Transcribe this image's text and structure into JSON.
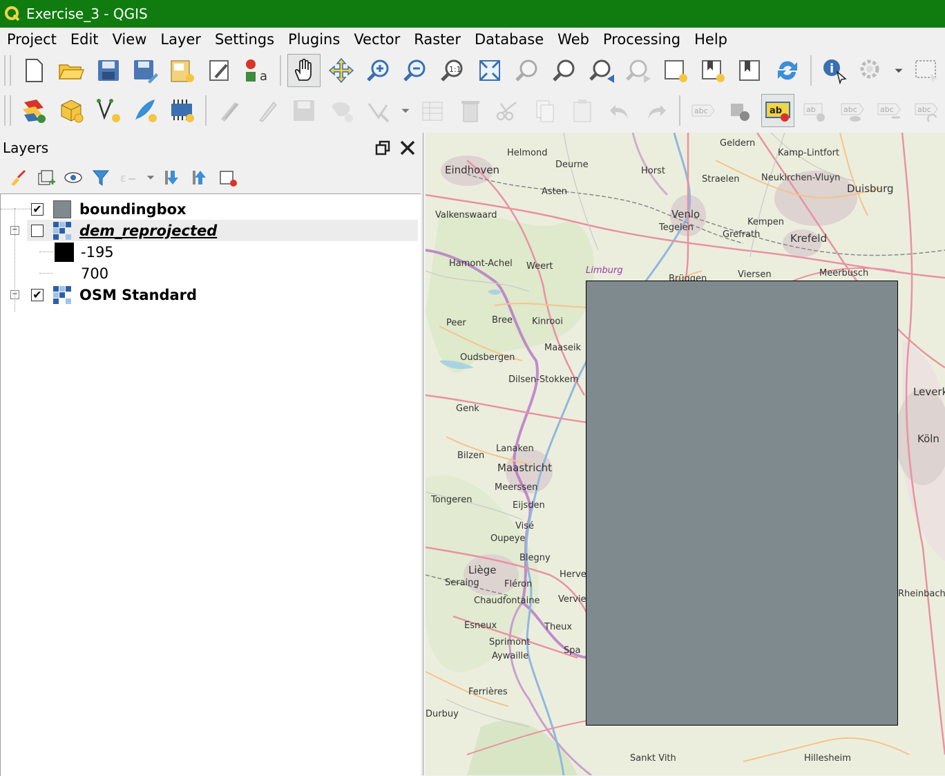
{
  "window": {
    "title": "Exercise_3 - QGIS"
  },
  "menu": [
    "Project",
    "Edit",
    "View",
    "Layer",
    "Settings",
    "Plugins",
    "Vector",
    "Raster",
    "Database",
    "Web",
    "Processing",
    "Help"
  ],
  "toolbar1": [
    "new-project",
    "open-project",
    "save-project",
    "save-as",
    "print-layout",
    "layout-manager",
    "style-manager",
    "pan-map",
    "pan-to-selection",
    "zoom-in",
    "zoom-out",
    "zoom-native",
    "zoom-full",
    "zoom-to-selection",
    "zoom-to-layer",
    "zoom-last",
    "zoom-next",
    "new-map-view",
    "new-bookmark",
    "show-bookmarks",
    "refresh",
    "identify",
    "action",
    "select"
  ],
  "toolbar2": [
    "data-source-manager",
    "new-geopackage-layer",
    "new-shapefile-layer",
    "new-temporary-layer",
    "new-virtual-layer",
    "current-edits",
    "toggle-editing",
    "save-edits",
    "digitize",
    "vertex-tool",
    "add-feature",
    "modify-attributes",
    "delete-selected",
    "cut",
    "copy",
    "paste",
    "undo",
    "redo",
    "label-tool",
    "pin-labels",
    "layer-labeling",
    "highlight-pinned",
    "show-hide-labels",
    "move-label",
    "rotate-label",
    "change-label"
  ],
  "layers_panel": {
    "title": "Layers",
    "layers": [
      {
        "name": "boundingbox",
        "checked": true,
        "symbol_color": "#7f8a8f"
      },
      {
        "name": "dem_reprojected",
        "checked": false,
        "legend": [
          {
            "label": "-195",
            "color": "#000000"
          },
          {
            "label": "700"
          }
        ]
      },
      {
        "name": "OSM Standard",
        "checked": true
      }
    ]
  },
  "map": {
    "labels": [
      "Eindhoven",
      "Helmond",
      "Deurne",
      "Horst",
      "Geldern",
      "Kamp-Lintfort",
      "Duisburg",
      "Asten",
      "Venlo",
      "Tegelen",
      "Straelen",
      "Neukirchen-Vluyn",
      "Valkenswaard",
      "Kempen",
      "Krefeld",
      "Grefrath",
      "Hamont-Achel",
      "Weert",
      "Limburg",
      "Brüggen",
      "Viersen",
      "Meerbusch",
      "Peer",
      "Bree",
      "Kinrooi",
      "Maaseik",
      "Genk",
      "Dilsen-Stokkem",
      "Bilzen",
      "Lanaken",
      "Maastricht",
      "Tongeren",
      "Eijsden",
      "Visé",
      "Liège",
      "Seraing",
      "Fléron",
      "Chaudfontaine",
      "Esneux",
      "Sprimont",
      "Aywaille",
      "Theux",
      "Spa",
      "Ferrières",
      "Durbuy",
      "Sankt Vith",
      "Köln",
      "Leverkusen",
      "Hillesheim",
      "Oudsbergen",
      "Meerssen",
      "Oupeye",
      "Herve",
      "Verviers",
      "Blegny",
      "Rheinbach"
    ]
  }
}
